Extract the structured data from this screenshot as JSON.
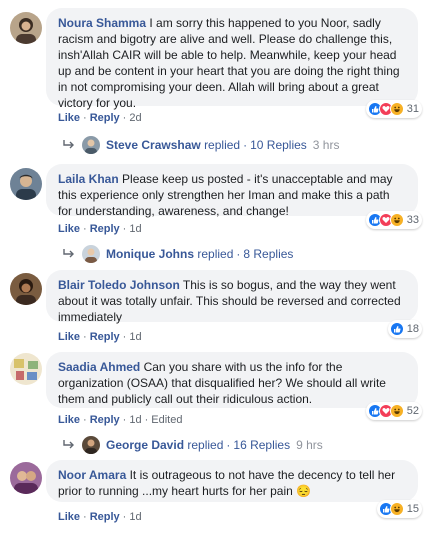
{
  "comments": [
    {
      "author": "Noura Shamma",
      "text": "I am sorry this happened to you Noor, sadly racism and bigotry are alive and well. Please do challenge this, insh'Allah CAIR will be able to help. Meanwhile, keep your head up and be content in your heart that you are doing the right thing in not compromising your deen. Allah will bring about a great victory for you.",
      "like_label": "Like",
      "reply_label": "Reply",
      "time": "2d",
      "reaction_count": "31",
      "reactions": [
        "like",
        "love",
        "haha"
      ],
      "replies": {
        "name": "Steve Crawshaw",
        "verb": "replied",
        "count_label": "10 Replies",
        "time": "3 hrs"
      }
    },
    {
      "author": "Laila Khan",
      "text": "Please keep us posted - it's unacceptable and may this experience only strengthen her Iman and make this a path for understanding, awareness, and change!",
      "like_label": "Like",
      "reply_label": "Reply",
      "time": "1d",
      "reaction_count": "33",
      "reactions": [
        "like",
        "love",
        "haha"
      ],
      "replies": {
        "name": "Monique Johns",
        "verb": "replied",
        "count_label": "8 Replies",
        "time": ""
      }
    },
    {
      "author": "Blair Toledo Johnson",
      "text": "This is so bogus, and the way they went about it was totally unfair. This should be reversed and corrected immediately",
      "like_label": "Like",
      "reply_label": "Reply",
      "time": "1d",
      "reaction_count": "18",
      "reactions": [
        "like"
      ]
    },
    {
      "author": "Saadia Ahmed",
      "text": "Can you share with us the info for the organization (OSAA) that disqualified her? We should all write them and publicly call out their ridiculous action.",
      "like_label": "Like",
      "reply_label": "Reply",
      "time": "1d",
      "edited_label": "Edited",
      "reaction_count": "52",
      "reactions": [
        "like",
        "love",
        "haha"
      ],
      "replies": {
        "name": "George David",
        "verb": "replied",
        "count_label": "16 Replies",
        "time": "9 hrs"
      }
    },
    {
      "author": "Noor Amara",
      "text": "It is outrageous to not have the decency to tell her prior to running ...my heart hurts for her pain 😔",
      "like_label": "Like",
      "reply_label": "Reply",
      "time": "1d",
      "reaction_count": "15",
      "reactions": [
        "like",
        "haha"
      ]
    }
  ],
  "colors": {
    "link": "#385898",
    "bubble": "#f2f3f5",
    "like": "#1877f2",
    "love": "#f33e58",
    "haha": "#f7b125"
  }
}
